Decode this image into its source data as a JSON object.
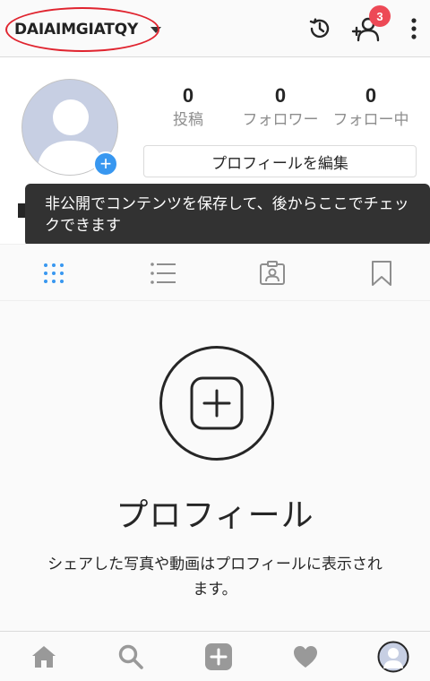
{
  "header": {
    "username": "DAIAIMGIATQY",
    "notification_count": "3"
  },
  "profile": {
    "stats": [
      {
        "value": "0",
        "label": "投稿"
      },
      {
        "value": "0",
        "label": "フォロワー"
      },
      {
        "value": "0",
        "label": "フォロー中"
      }
    ],
    "edit_button": "プロフィールを編集"
  },
  "tooltip": {
    "text": "非公開でコンテンツを保存して、後からここでチェックできます"
  },
  "tabs": [
    "grid-icon",
    "list-icon",
    "tagged-icon",
    "saved-icon"
  ],
  "empty_state": {
    "title": "プロフィール",
    "description": "シェアした写真や動画はプロフィールに表示されます。"
  },
  "bottom_nav": [
    "home-icon",
    "search-icon",
    "add-post-icon",
    "activity-heart-icon",
    "profile-avatar-icon"
  ],
  "colors": {
    "accent": "#3897f0",
    "badge": "#ed4956",
    "highlight_ellipse": "#e0242f",
    "tooltip_bg": "#323232"
  }
}
